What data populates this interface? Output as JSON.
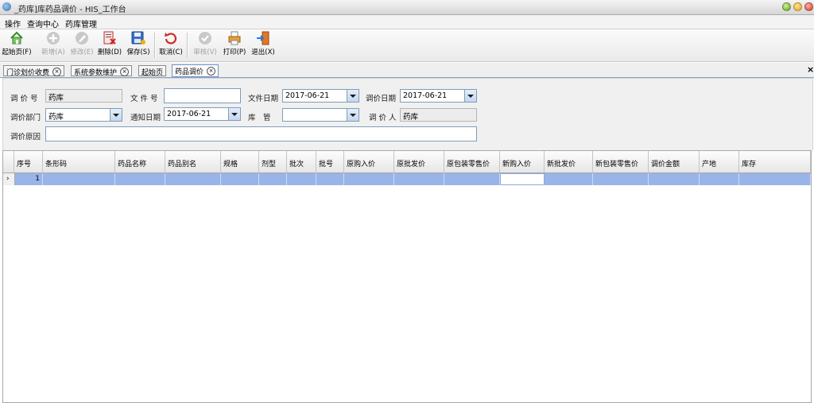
{
  "window": {
    "title": "_药库]库药品调价 - HIS_工作台"
  },
  "menu": [
    "操作",
    "查询中心",
    "药库管理"
  ],
  "toolbar": {
    "buttons": [
      {
        "label": "起始页(F)",
        "icon": "home-icon",
        "enabled": true
      },
      {
        "label": "新增(A)",
        "icon": "add-icon",
        "enabled": false
      },
      {
        "label": "修改(E)",
        "icon": "edit-icon",
        "enabled": false
      },
      {
        "label": "删除(D)",
        "icon": "delete-icon",
        "enabled": true
      },
      {
        "label": "保存(S)",
        "icon": "save-icon",
        "enabled": true
      },
      {
        "label": "取消(C)",
        "icon": "undo-icon",
        "enabled": true
      },
      {
        "label": "审核(V)",
        "icon": "check-icon",
        "enabled": false
      },
      {
        "label": "打印(P)",
        "icon": "print-icon",
        "enabled": true
      },
      {
        "label": "退出(X)",
        "icon": "exit-icon",
        "enabled": true
      }
    ]
  },
  "tabs": [
    {
      "label": "门诊划价收费",
      "active": false
    },
    {
      "label": "系统参数维护",
      "active": false
    },
    {
      "label": "起始页",
      "active": false
    },
    {
      "label": "药品调价",
      "active": true
    }
  ],
  "form": {
    "adjust_no_label": "调 价 号",
    "adjust_no_value": "药库",
    "file_no_label": "文 件 号",
    "file_no_value": "",
    "file_date_label": "文件日期",
    "file_date_value": "2017-06-21",
    "adjust_date_label": "调价日期",
    "adjust_date_value": "2017-06-21",
    "dept_label": "调价部门",
    "dept_value": "药库",
    "notice_date_label": "通知日期",
    "notice_date_value": "2017-06-21",
    "keeper_label": "库　管",
    "keeper_value": "",
    "adjuster_label": "调 价 人",
    "adjuster_value": "药库",
    "reason_label": "调价原因",
    "reason_value": ""
  },
  "grid": {
    "columns": [
      "序号",
      "条形码",
      "药品名称",
      "药品别名",
      "规格",
      "剂型",
      "批次",
      "批号",
      "原购入价",
      "原批发价",
      "原包装零售价",
      "新购入价",
      "新批发价",
      "新包装零售价",
      "调价金额",
      "产地",
      "库存"
    ],
    "rows": [
      {
        "indicator": "›",
        "no": "1"
      }
    ]
  }
}
